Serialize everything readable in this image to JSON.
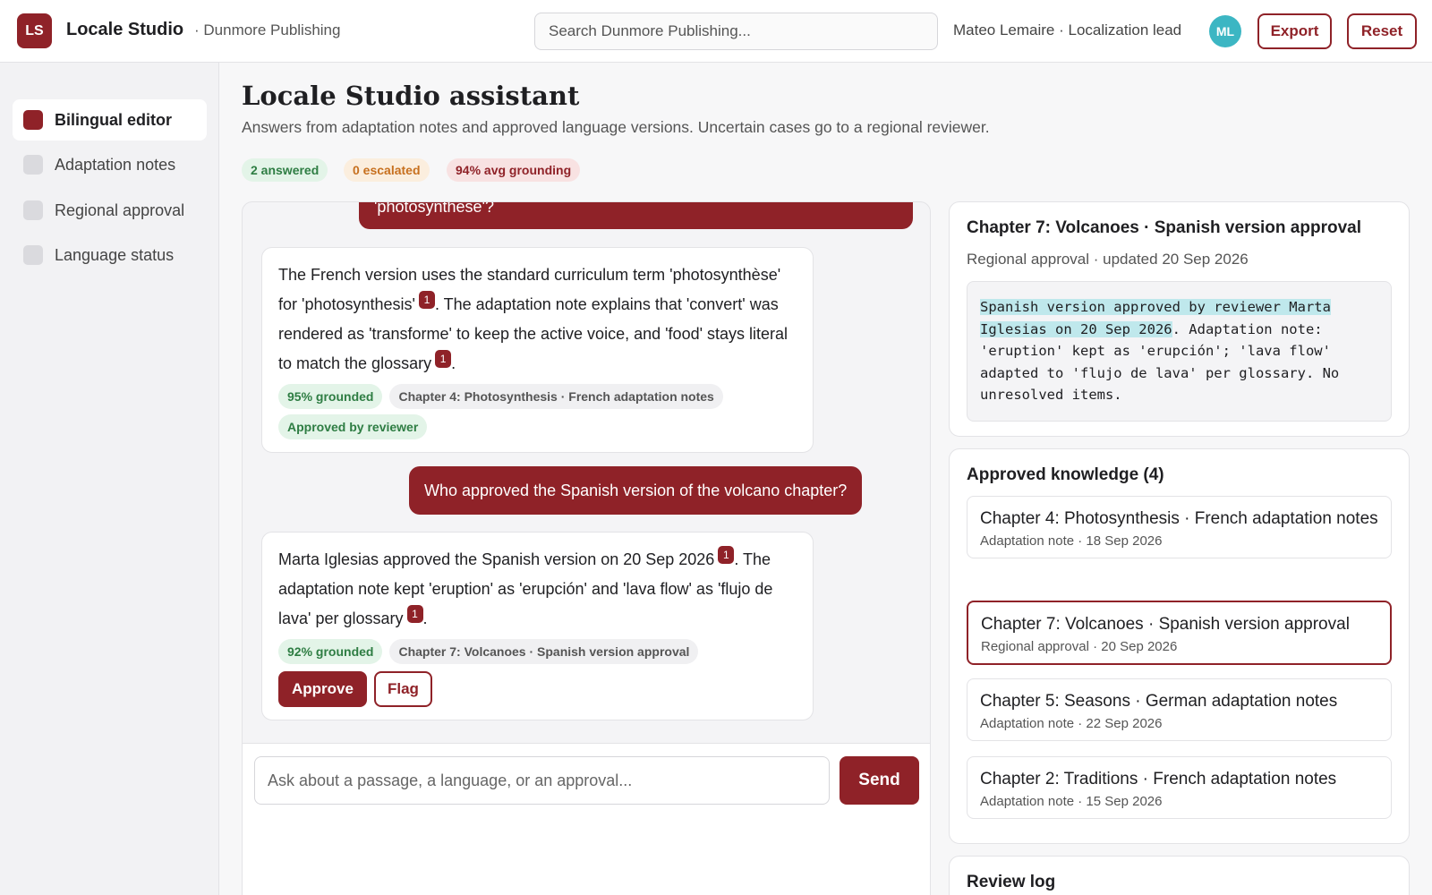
{
  "topbar": {
    "logo_text": "LS",
    "app_name": "Locale Studio",
    "org_name": "· Dunmore Publishing",
    "search_placeholder": "Search Dunmore Publishing...",
    "user_label": "Mateo Lemaire · Localization lead",
    "avatar_initials": "ML",
    "export_label": "Export",
    "reset_label": "Reset"
  },
  "sidebar": {
    "items": [
      {
        "label": "Bilingual editor",
        "active": true
      },
      {
        "label": "Adaptation notes",
        "active": false
      },
      {
        "label": "Regional approval",
        "active": false
      },
      {
        "label": "Language status",
        "active": false
      }
    ]
  },
  "main": {
    "title": "Locale Studio assistant",
    "subtitle": "Answers from adaptation notes and approved language versions. Uncertain cases go to a regional reviewer.",
    "stats": {
      "answered": "2 answered",
      "escalated": "0 escalated",
      "grounding": "94% avg grounding"
    }
  },
  "chat": {
    "user_msg_1_tail": "'photosynthese'?",
    "answer_1": {
      "text_a": "The French version uses the standard curriculum term 'photosynthèse' for 'photosynthesis'",
      "cite_a": "1",
      "text_b": ". The adaptation note explains that 'convert' was rendered as 'transforme' to keep the active voice, and 'food' stays literal to match the glossary",
      "cite_b": "1",
      "text_c": ".",
      "grounded": "95% grounded",
      "source": "Chapter 4: Photosynthesis · French adaptation notes",
      "status": "Approved by reviewer"
    },
    "user_msg_2": "Who approved the Spanish version of the volcano chapter?",
    "answer_2": {
      "text_a": "Marta Iglesias approved the Spanish version on 20 Sep 2026",
      "cite_a": "1",
      "text_b": ". The adaptation note kept 'eruption' as 'erupción' and 'lava flow' as 'flujo de lava' per glossary",
      "cite_b": "1",
      "text_c": ".",
      "grounded": "92% grounded",
      "source": "Chapter 7: Volcanoes · Spanish version approval",
      "approve_label": "Approve",
      "flag_label": "Flag"
    },
    "composer_placeholder": "Ask about a passage, a language, or an approval...",
    "send_label": "Send"
  },
  "detail": {
    "title": "Chapter 7: Volcanoes · Spanish version approval",
    "meta": "Regional approval · updated 20 Sep 2026",
    "highlight": "Spanish version approved by reviewer Marta Iglesias on 20 Sep 2026",
    "rest": ". Adaptation note: 'eruption' kept as 'erupción'; 'lava flow' adapted to 'flujo de lava' per glossary. No unresolved items."
  },
  "knowledge": {
    "title": "Approved knowledge (4)",
    "items": [
      {
        "name": "Chapter 4: Photosynthesis · French adaptation notes",
        "meta": "Adaptation note · 18 Sep 2026",
        "active": false
      },
      {
        "name": "Chapter 7: Volcanoes · Spanish version approval",
        "meta": "Regional approval · 20 Sep 2026",
        "active": true
      },
      {
        "name": "Chapter 5: Seasons · German adaptation notes",
        "meta": "Adaptation note · 22 Sep 2026",
        "active": false
      },
      {
        "name": "Chapter 2: Traditions · French adaptation notes",
        "meta": "Adaptation note · 15 Sep 2026",
        "active": false
      }
    ]
  },
  "review_log": {
    "title": "Review log"
  },
  "colors": {
    "accent": "#8f2228",
    "avatar": "#3cb6c3",
    "highlight": "#bfe8ec"
  }
}
